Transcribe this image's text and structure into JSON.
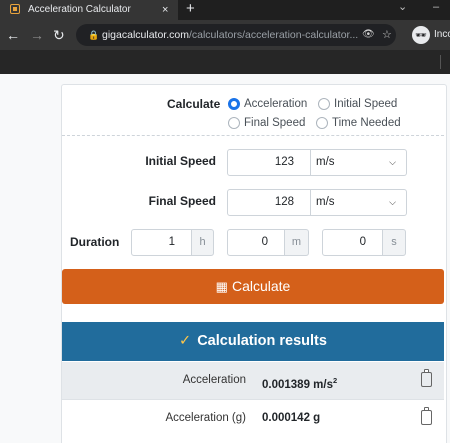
{
  "browser": {
    "tab_title": "Acceleration Calculator",
    "tab_close": "×",
    "new_tab": "+",
    "url_host": "gigacalculator.com",
    "url_path": "/calculators/acceleration-calculator...",
    "incognito_label": "Inco"
  },
  "form": {
    "calculate_label": "Calculate",
    "options": [
      {
        "label": "Acceleration",
        "selected": true
      },
      {
        "label": "Initial Speed",
        "selected": false
      },
      {
        "label": "Final Speed",
        "selected": false
      },
      {
        "label": "Time Needed",
        "selected": false
      }
    ],
    "initial_speed": {
      "label": "Initial Speed",
      "value": "123",
      "unit": "m/s"
    },
    "final_speed": {
      "label": "Final Speed",
      "value": "128",
      "unit": "m/s"
    },
    "duration": {
      "label": "Duration",
      "hours": {
        "value": "1",
        "unit": "h"
      },
      "minutes": {
        "value": "0",
        "unit": "m"
      },
      "seconds": {
        "value": "0",
        "unit": "s"
      }
    },
    "calculate_button": "Calculate"
  },
  "results": {
    "header": "Calculation results",
    "rows": [
      {
        "label": "Acceleration",
        "value": "0.001389 m/s",
        "sup": "2"
      },
      {
        "label": "Acceleration (g)",
        "value": "0.000142 g"
      }
    ]
  },
  "colors": {
    "accent_blue": "#1a73e8",
    "button_orange": "#d4601a",
    "results_header": "#216c9c",
    "check_yellow": "#ffc74a"
  }
}
